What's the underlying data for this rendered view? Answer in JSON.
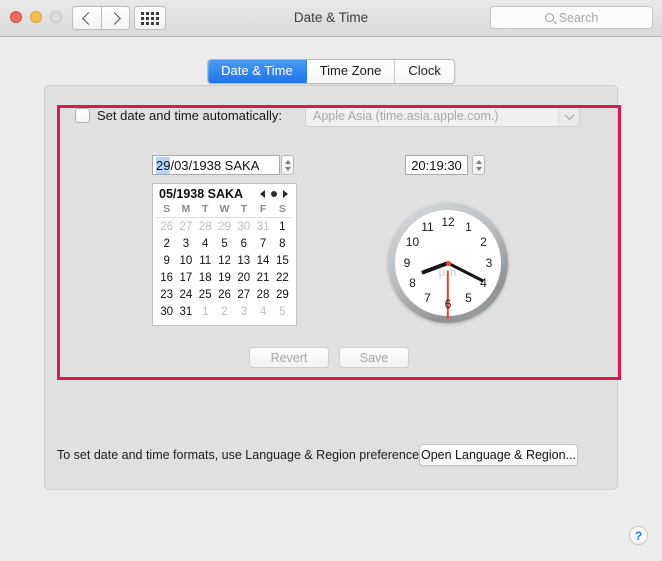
{
  "window": {
    "title": "Date & Time",
    "traffic_lights": [
      "close",
      "minimize",
      "zoom"
    ],
    "nav_back": "‹",
    "nav_forward": "›",
    "grid_button": "show-all"
  },
  "search": {
    "placeholder": "Search",
    "value": ""
  },
  "tabs": [
    {
      "label": "Date & Time",
      "active": true
    },
    {
      "label": "Time Zone",
      "active": false
    },
    {
      "label": "Clock",
      "active": false
    }
  ],
  "auto_row": {
    "checkbox_checked": false,
    "label": "Set date and time automatically:",
    "server_value": "Apple Asia (time.asia.apple.com.)",
    "server_enabled": false
  },
  "date_field": {
    "selected_part": "29",
    "rest": "/03/1938 SAKA",
    "full_value": "29/03/1938 SAKA"
  },
  "time_field": {
    "value": "20:19:30"
  },
  "calendar": {
    "month_label": "05/1938 SAKA",
    "weekdays": [
      "S",
      "M",
      "T",
      "W",
      "T",
      "F",
      "S"
    ],
    "weeks": [
      [
        {
          "d": "26",
          "dim": true
        },
        {
          "d": "27",
          "dim": true
        },
        {
          "d": "28",
          "dim": true
        },
        {
          "d": "29",
          "dim": true
        },
        {
          "d": "30",
          "dim": true
        },
        {
          "d": "31",
          "dim": true
        },
        {
          "d": "1",
          "dim": false
        }
      ],
      [
        {
          "d": "2",
          "dim": false
        },
        {
          "d": "3",
          "dim": false
        },
        {
          "d": "4",
          "dim": false
        },
        {
          "d": "5",
          "dim": false
        },
        {
          "d": "6",
          "dim": false
        },
        {
          "d": "7",
          "dim": false
        },
        {
          "d": "8",
          "dim": false
        }
      ],
      [
        {
          "d": "9",
          "dim": false
        },
        {
          "d": "10",
          "dim": false
        },
        {
          "d": "11",
          "dim": false
        },
        {
          "d": "12",
          "dim": false
        },
        {
          "d": "13",
          "dim": false
        },
        {
          "d": "14",
          "dim": false
        },
        {
          "d": "15",
          "dim": false
        }
      ],
      [
        {
          "d": "16",
          "dim": false
        },
        {
          "d": "17",
          "dim": false
        },
        {
          "d": "18",
          "dim": false
        },
        {
          "d": "19",
          "dim": false
        },
        {
          "d": "20",
          "dim": false
        },
        {
          "d": "21",
          "dim": false
        },
        {
          "d": "22",
          "dim": false
        }
      ],
      [
        {
          "d": "23",
          "dim": false
        },
        {
          "d": "24",
          "dim": false
        },
        {
          "d": "25",
          "dim": false
        },
        {
          "d": "26",
          "dim": false
        },
        {
          "d": "27",
          "dim": false
        },
        {
          "d": "28",
          "dim": false
        },
        {
          "d": "29",
          "dim": false
        }
      ],
      [
        {
          "d": "30",
          "dim": false
        },
        {
          "d": "31",
          "dim": false
        },
        {
          "d": "1",
          "dim": true
        },
        {
          "d": "2",
          "dim": true
        },
        {
          "d": "3",
          "dim": true
        },
        {
          "d": "4",
          "dim": true
        },
        {
          "d": "5",
          "dim": true
        }
      ]
    ]
  },
  "clock": {
    "hour_numbers": [
      "12",
      "1",
      "2",
      "3",
      "4",
      "5",
      "6",
      "7",
      "8",
      "9",
      "10",
      "11"
    ],
    "meridiem": "pm",
    "hour_angle": 249.5,
    "minute_angle": 117,
    "second_angle": 180,
    "second_hand_color": "#e8422c"
  },
  "action_buttons": {
    "revert": "Revert",
    "save": "Save",
    "enabled": false
  },
  "footer": {
    "note": "To set date and time formats, use Language & Region preferences.",
    "open_button": "Open Language & Region...",
    "help": "?"
  },
  "annotation": {
    "highlight_color": "#d81b4a"
  }
}
